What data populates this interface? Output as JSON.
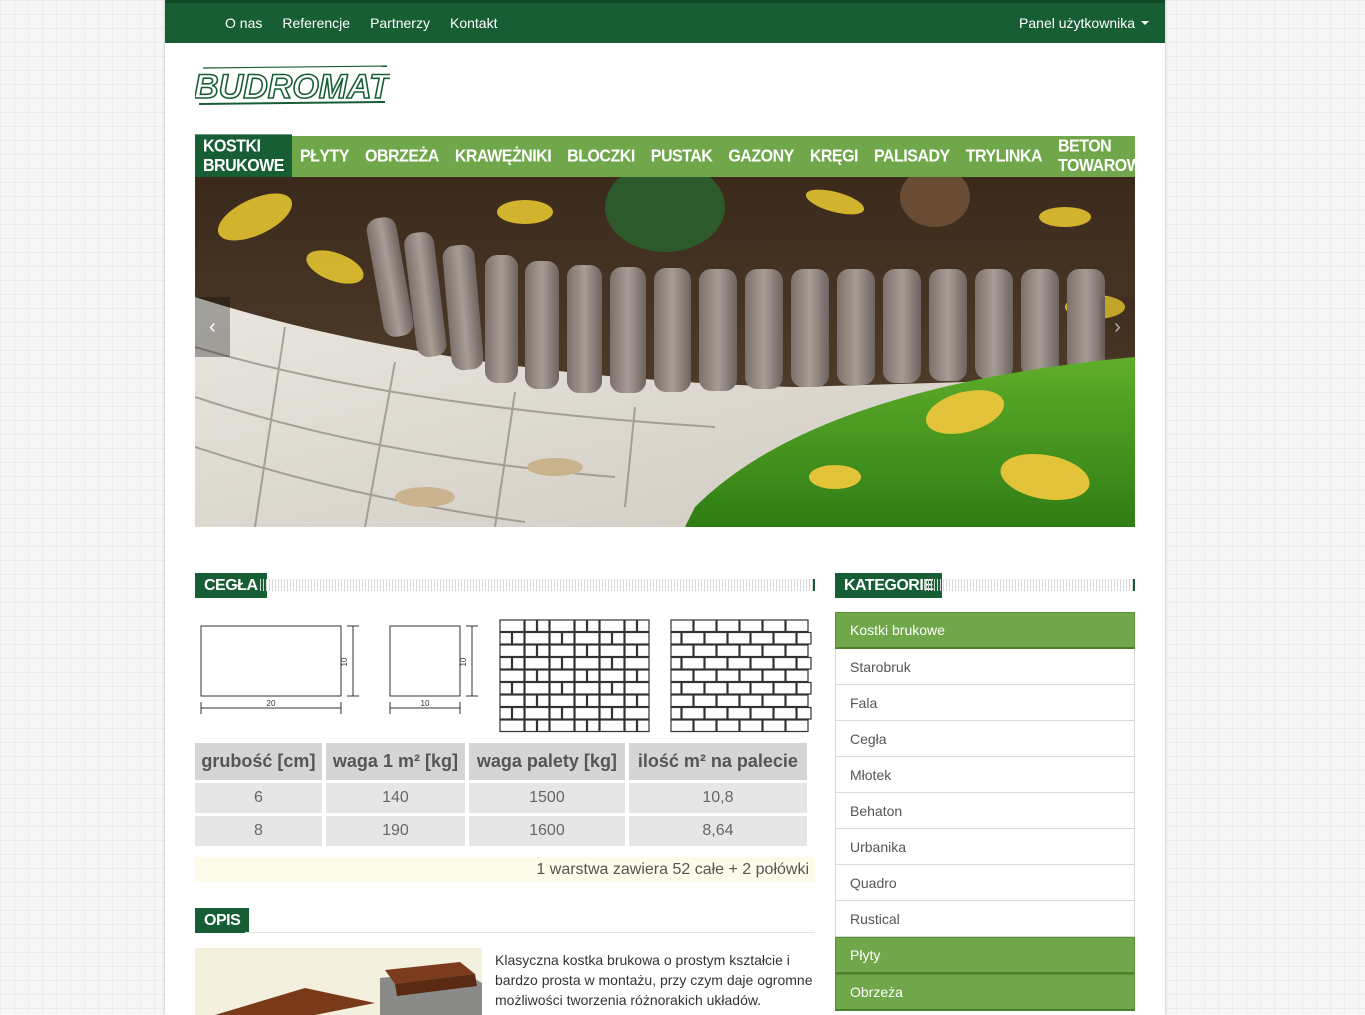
{
  "topnav": {
    "links": [
      "O nas",
      "Referencje",
      "Partnerzy",
      "Kontakt"
    ],
    "user_panel": "Panel użytkownika"
  },
  "logo": {
    "text": "BUDROMAT"
  },
  "mainnav": {
    "items": [
      "KOSTKI BRUKOWE",
      "PŁYTY",
      "OBRZEŻA",
      "KRAWĘŻNIKI",
      "BLOCZKI",
      "PUSTAK",
      "GAZONY",
      "KRĘGI",
      "PALISADY",
      "TRYLINKA",
      "BETON TOWAROWY"
    ],
    "active": "KOSTKI BRUKOWE"
  },
  "slider": {
    "prev_icon": "chevron-left-icon",
    "next_icon": "chevron-right-icon",
    "prev": "‹",
    "next": "›"
  },
  "product": {
    "title": "CEGŁA",
    "drawing_labels": {
      "brick_w": "20",
      "brick_h": "10",
      "half_w": "10",
      "half_h": "10"
    },
    "table": {
      "headers": [
        "grubość [cm]",
        "waga 1 m² [kg]",
        "waga palety [kg]",
        "ilość m² na palecie"
      ],
      "rows": [
        [
          "6",
          "140",
          "1500",
          "10,8"
        ],
        [
          "8",
          "190",
          "1600",
          "8,64"
        ]
      ],
      "note": "1 warstwa zawiera 52 całe + 2 połówki"
    }
  },
  "opis": {
    "title": "OPIS",
    "text": "Klasyczna kostka brukowa o prostym kształcie i bardzo prosta w montażu, przy czym daje ogromne możliwości tworzenia różnorakich układów."
  },
  "categories": {
    "title": "KATEGORIE",
    "items": [
      {
        "label": "Kostki brukowe",
        "group": true
      },
      {
        "label": "Starobruk",
        "group": false
      },
      {
        "label": "Fala",
        "group": false
      },
      {
        "label": "Cegła",
        "group": false
      },
      {
        "label": "Młotek",
        "group": false
      },
      {
        "label": "Behaton",
        "group": false
      },
      {
        "label": "Urbanika",
        "group": false
      },
      {
        "label": "Quadro",
        "group": false
      },
      {
        "label": "Rustical",
        "group": false
      },
      {
        "label": "Płyty",
        "group": true
      },
      {
        "label": "Obrzeża",
        "group": true
      }
    ]
  },
  "colors": {
    "dark_green": "#175e35",
    "light_green": "#6fa74a"
  }
}
